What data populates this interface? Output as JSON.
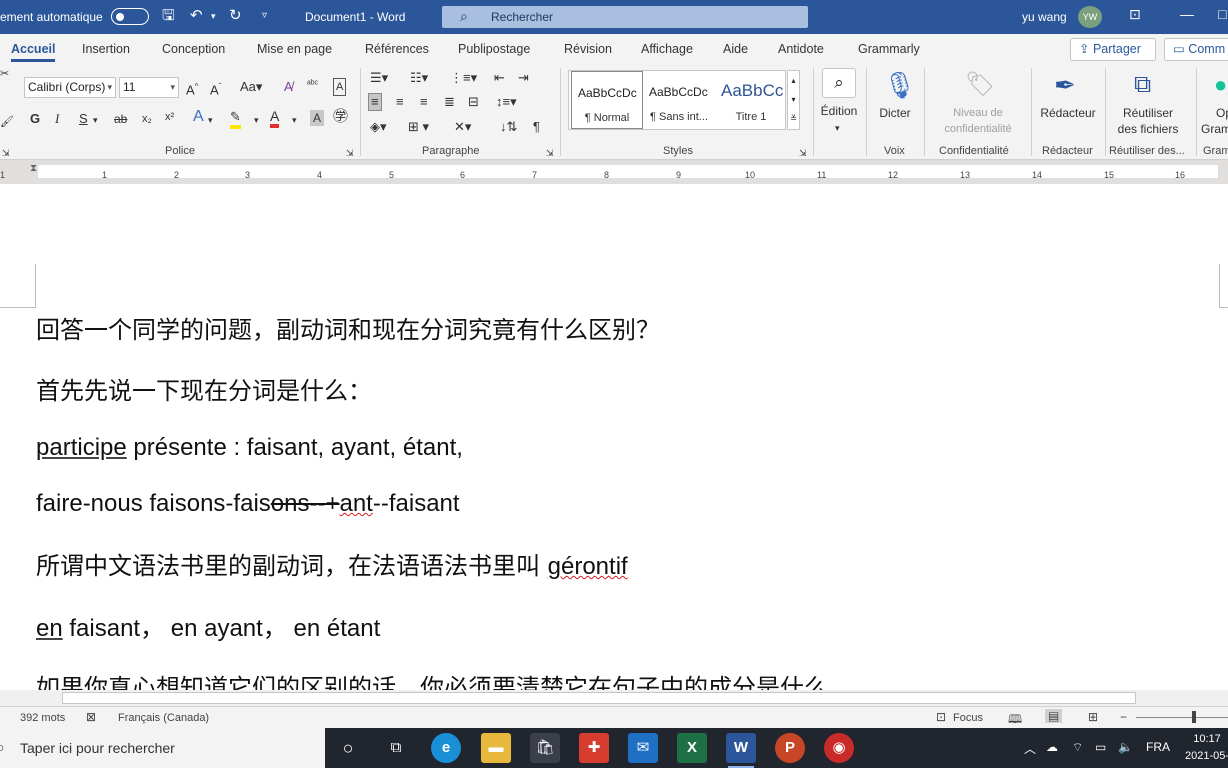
{
  "titlebar": {
    "autosave_label": "ement automatique",
    "doc_title": "Document1 - Word",
    "search_text": "Rechercher",
    "username": "yu wang",
    "avatar_initials": "YW",
    "accent": "#2b579a"
  },
  "tabs": [
    "Accueil",
    "Insertion",
    "Conception",
    "Mise en page",
    "Références",
    "Publipostage",
    "Révision",
    "Affichage",
    "Aide",
    "Antidote",
    "Grammarly"
  ],
  "share_label": "Partager",
  "comments_label": "Comm",
  "ribbon": {
    "font_name": "Calibri (Corps)",
    "font_size": "11",
    "font_group": "Police",
    "paragraph_group": "Paragraphe",
    "styles_group": "Styles",
    "styles": [
      {
        "sample": "AaBbCcDc",
        "name": "¶ Normal"
      },
      {
        "sample": "AaBbCcDc",
        "name": "¶ Sans int..."
      },
      {
        "sample": "AaBbCc",
        "name": "Titre 1"
      }
    ],
    "edition_label": "Édition",
    "dictate_label": "Dicter",
    "voice_group": "Voix",
    "confidentiality_label_1": "Niveau de",
    "confidentiality_label_2": "confidentialité",
    "confidentiality_group": "Confidentialité",
    "redacteur_label": "Rédacteur",
    "redacteur_group": "Rédacteur",
    "reuse_label_1": "Réutiliser",
    "reuse_label_2": "des fichiers",
    "reuse_group": "Réutiliser des...",
    "gram_label": "Op",
    "gram_label_2": "Gram",
    "gram_group": "Gram"
  },
  "ruler_numbers": [
    "1",
    "1",
    "2",
    "3",
    "4",
    "5",
    "6",
    "7",
    "8",
    "9",
    "10",
    "11",
    "12",
    "13",
    "14",
    "15",
    "16"
  ],
  "document": {
    "line1": "回答一个同学的问题，副动词和现在分词究竟有什么区别？",
    "line2": "首先先说一下现在分词是什么：",
    "line3_a": "participe",
    "line3_b": " présente : faisant, ayant, étant,",
    "line4_a": "faire-nous faisons-fais",
    "line4_b": "ons--+",
    "line4_c": "ant",
    "line4_d": "--faisant",
    "line5_a": "所谓中文语法书里的副动词，在法语语法书里叫 ",
    "line5_b": "gérontif",
    "line6_a": "en",
    "line6_b": " faisant， en ayant， en étant",
    "line7": "如果你真心想知道它们的区别的话，你必须要清楚它在句子中的成分是什么"
  },
  "statusbar": {
    "word_count": "392 mots",
    "language": "Français (Canada)",
    "focus": "Focus"
  },
  "taskbar": {
    "search_placeholder": "Taper ici pour rechercher",
    "lang": "FRA",
    "time": "10:17",
    "date": "2021-05-"
  }
}
